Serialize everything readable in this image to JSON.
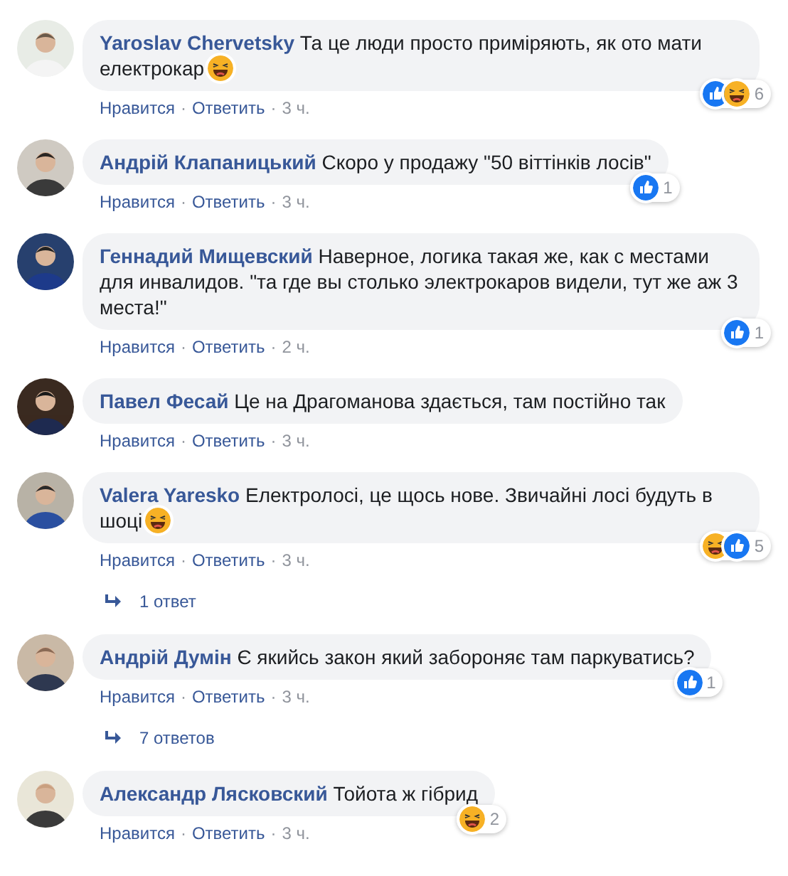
{
  "comments": [
    {
      "author": "Yaroslav Chervetsky",
      "text": "Та це люди просто приміряють, як ото мати електрокар",
      "trailing_emoji": true,
      "reactions": {
        "items": [
          {
            "kind": "like"
          },
          {
            "kind": "haha"
          }
        ],
        "count": "6"
      },
      "actions": [
        "Нравится",
        "Ответить"
      ],
      "separator": "·",
      "time": "3 ч."
    },
    {
      "author": "Андрій Клапаницький",
      "text": "Скоро у продажу \"50 віттінків лосів\"",
      "trailing_emoji": false,
      "reactions": {
        "items": [
          {
            "kind": "like"
          }
        ],
        "count": "1"
      },
      "actions": [
        "Нравится",
        "Ответить"
      ],
      "separator": "·",
      "time": "3 ч."
    },
    {
      "author": "Геннадий Мищевский",
      "text": "Наверное, логика такая же, как с местами для инвалидов. \"та где вы столько электрокаров видели, тут же аж 3 места!\"",
      "trailing_emoji": false,
      "reactions": {
        "items": [
          {
            "kind": "like"
          }
        ],
        "count": "1"
      },
      "actions": [
        "Нравится",
        "Ответить"
      ],
      "separator": "·",
      "time": "2 ч."
    },
    {
      "author": "Павел Фесай",
      "text": "Це на Драгоманова здається, там постійно так",
      "trailing_emoji": false,
      "actions": [
        "Нравится",
        "Ответить"
      ],
      "separator": "·",
      "time": "3 ч."
    },
    {
      "author": "Valera Yaresko",
      "text": "Електролосі, це щось нове. Звичайні лосі будуть в шоці",
      "trailing_emoji": true,
      "reactions": {
        "items": [
          {
            "kind": "haha"
          },
          {
            "kind": "like"
          }
        ],
        "count": "5"
      },
      "actions": [
        "Нравится",
        "Ответить"
      ],
      "separator": "·",
      "time": "3 ч.",
      "replies": "1 ответ"
    },
    {
      "author": "Андрій Думін",
      "text": "Є якийсь закон який забороняє там паркуватись?",
      "trailing_emoji": false,
      "reactions": {
        "items": [
          {
            "kind": "like"
          }
        ],
        "count": "1"
      },
      "actions": [
        "Нравится",
        "Ответить"
      ],
      "separator": "·",
      "time": "3 ч.",
      "replies": "7 ответов"
    },
    {
      "author": "Александр Лясковский",
      "text": "Тойота ж гібрид",
      "trailing_emoji": false,
      "reactions": {
        "items": [
          {
            "kind": "haha"
          }
        ],
        "count": "2"
      },
      "actions": [
        "Нравится",
        "Ответить"
      ],
      "separator": "·",
      "time": "3 ч."
    }
  ]
}
